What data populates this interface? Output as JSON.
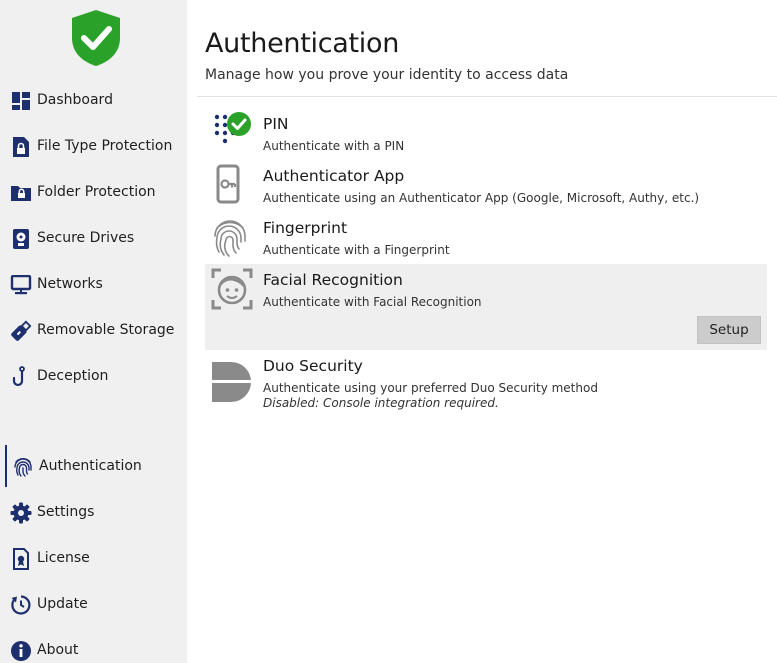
{
  "colors": {
    "accent": "#1e2f6e",
    "shield_green": "#2aa22a",
    "sidebar_bg": "#f0f0f0",
    "highlight_bg": "#efefef",
    "icon_gray": "#8a8a8a"
  },
  "sidebar": {
    "logo_icon": "shield-check-icon",
    "items": [
      {
        "label": "Dashboard",
        "icon": "dashboard-icon"
      },
      {
        "label": "File Type Protection",
        "icon": "file-lock-icon"
      },
      {
        "label": "Folder Protection",
        "icon": "folder-lock-icon"
      },
      {
        "label": "Secure Drives",
        "icon": "drive-icon"
      },
      {
        "label": "Networks",
        "icon": "monitor-icon"
      },
      {
        "label": "Removable Storage",
        "icon": "usb-icon"
      },
      {
        "label": "Deception",
        "icon": "hook-icon"
      },
      {
        "label": "Authentication",
        "icon": "fingerprint-icon",
        "active": true
      },
      {
        "label": "Settings",
        "icon": "gear-icon"
      },
      {
        "label": "License",
        "icon": "license-icon"
      },
      {
        "label": "Update",
        "icon": "update-icon"
      },
      {
        "label": "About",
        "icon": "info-icon"
      }
    ]
  },
  "main": {
    "title": "Authentication",
    "subtitle": "Manage how you prove your identity to access data",
    "methods": [
      {
        "name": "PIN",
        "description": "Authenticate with a PIN",
        "icon": "pin-keypad-icon",
        "enabled": true
      },
      {
        "name": "Authenticator App",
        "description": "Authenticate using an Authenticator App (Google, Microsoft, Authy, etc.)",
        "icon": "phone-key-icon"
      },
      {
        "name": "Fingerprint",
        "description": "Authenticate with a Fingerprint",
        "icon": "fingerprint-icon"
      },
      {
        "name": "Facial Recognition",
        "description": "Authenticate with Facial Recognition",
        "icon": "face-scan-icon",
        "selected": true,
        "button": "Setup"
      },
      {
        "name": "Duo Security",
        "description": "Authenticate using your preferred Duo Security method",
        "note": "Disabled: Console integration required.",
        "icon": "duo-icon"
      }
    ]
  }
}
